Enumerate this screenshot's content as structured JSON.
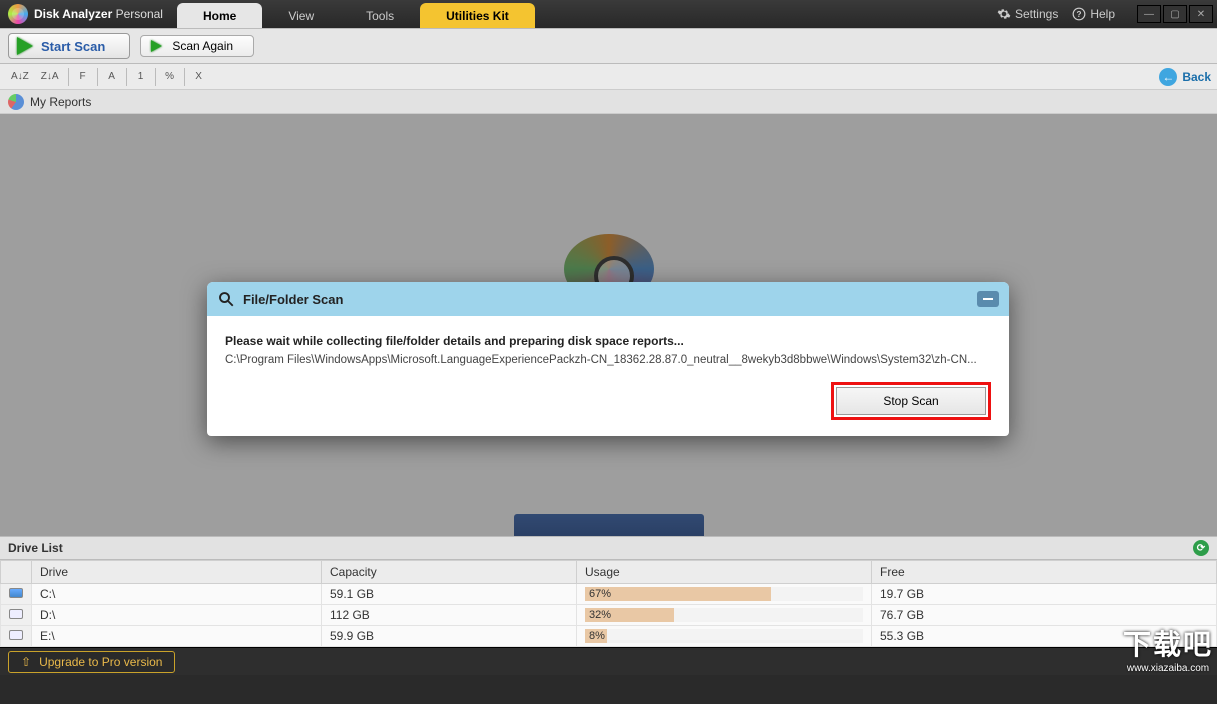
{
  "app": {
    "name_strong": "Disk Analyzer",
    "name_light": " Personal"
  },
  "tabs": {
    "home": "Home",
    "view": "View",
    "tools": "Tools",
    "utilities": "Utilities Kit"
  },
  "titlebar_links": {
    "settings": "Settings",
    "help": "Help"
  },
  "ribbon": {
    "start_scan": "Start Scan",
    "scan_again": "Scan Again"
  },
  "toolstrip": {
    "az": "A↓Z",
    "za": "Z↓A",
    "f": "F",
    "a": "A",
    "one": "1",
    "pct": "%",
    "x": "X",
    "back": "Back"
  },
  "reports_label": "My Reports",
  "drive_section": "Drive List",
  "columns": {
    "drive": "Drive",
    "capacity": "Capacity",
    "usage": "Usage",
    "free": "Free"
  },
  "drives": [
    {
      "name": "C:\\",
      "capacity": "59.1 GB",
      "usage_pct": 67,
      "usage_label": "67%",
      "free": "19.7 GB"
    },
    {
      "name": "D:\\",
      "capacity": "112 GB",
      "usage_pct": 32,
      "usage_label": "32%",
      "free": "76.7 GB"
    },
    {
      "name": "E:\\",
      "capacity": "59.9 GB",
      "usage_pct": 8,
      "usage_label": "8%",
      "free": "55.3 GB"
    }
  ],
  "upgrade": "Upgrade to Pro version",
  "modal": {
    "title": "File/Folder Scan",
    "message": "Please wait while collecting file/folder details and preparing disk space reports...",
    "path": "C:\\Program Files\\WindowsApps\\Microsoft.LanguageExperiencePackzh-CN_18362.28.87.0_neutral__8wekyb3d8bbwe\\Windows\\System32\\zh-CN...",
    "stop": "Stop Scan"
  },
  "watermark": {
    "big": "下载吧",
    "url": "www.xiazaiba.com"
  }
}
